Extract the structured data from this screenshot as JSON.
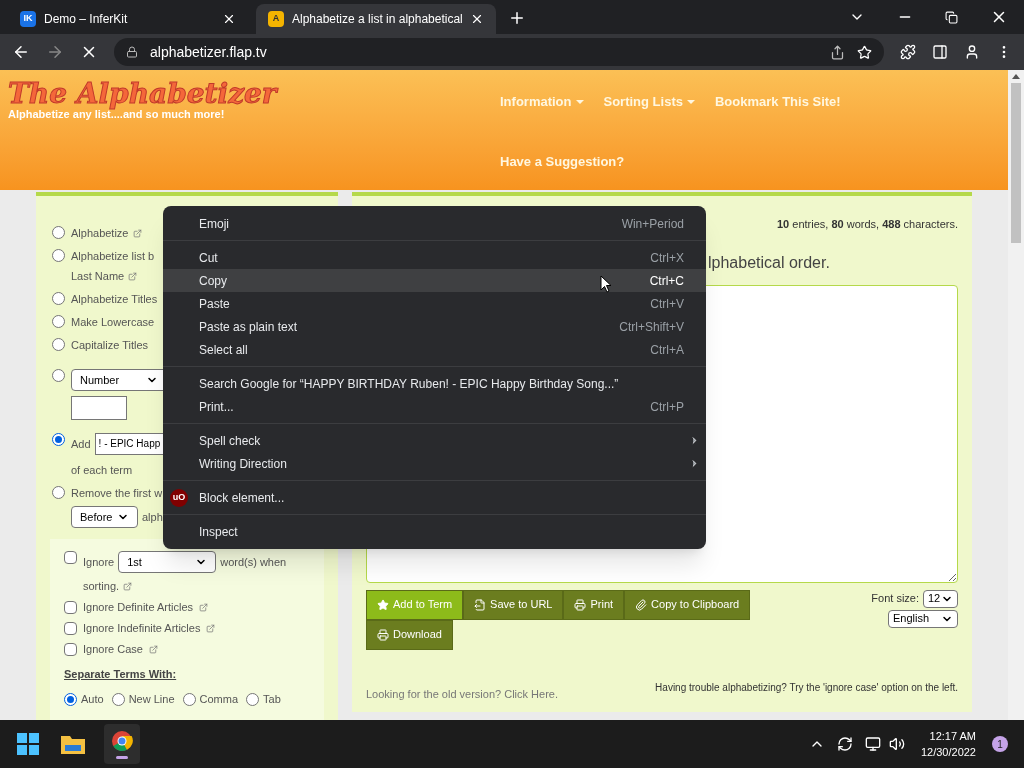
{
  "browser": {
    "tabs": [
      {
        "title": "Demo – InferKit",
        "icon_text": "IK",
        "selected": false
      },
      {
        "title": "Alphabetize a list in alphabetical",
        "icon_text": "A",
        "selected": true
      }
    ],
    "address": "alphabetizer.flap.tv"
  },
  "header": {
    "logo": "The Alphabetizer",
    "tagline": "Alphabetize any list....and so much more!",
    "nav": [
      {
        "label": "Information",
        "dropdown": true
      },
      {
        "label": "Sorting Lists",
        "dropdown": true
      },
      {
        "label": "Bookmark This Site!",
        "dropdown": false
      },
      {
        "label": "Have a Suggestion?",
        "dropdown": false
      }
    ]
  },
  "options": [
    {
      "kind": "radio",
      "label": "Alphabetize",
      "selected": false,
      "link": true
    },
    {
      "kind": "radio",
      "label": "Alphabetize list b",
      "selected": false,
      "link": true,
      "second_line": "Last Name"
    },
    {
      "kind": "radio",
      "label": "Alphabetize Titles",
      "selected": false,
      "link": false
    },
    {
      "kind": "radio",
      "label": "Make Lowercase",
      "selected": false,
      "link": false
    },
    {
      "kind": "radio",
      "label": "Capitalize Titles",
      "selected": false,
      "link": false
    },
    {
      "kind": "number",
      "select": "Number",
      "selected": false
    },
    {
      "kind": "add",
      "label": "Add",
      "value": "! - EPIC Happ",
      "after": "of each term",
      "selected": true
    },
    {
      "kind": "remove",
      "label": "Remove the first w",
      "select": "Before",
      "after": "alph",
      "selected": false
    }
  ],
  "ignore": {
    "checks": [
      {
        "kind": "words",
        "label": "Ignore",
        "select": "1st",
        "after": "word(s) when",
        "second_line": "sorting.",
        "checked": false
      },
      {
        "kind": "plain",
        "label": "Ignore Definite Articles",
        "checked": false
      },
      {
        "kind": "plain",
        "label": "Ignore Indefinite Articles",
        "checked": false
      },
      {
        "kind": "plain",
        "label": "Ignore Case",
        "checked": false
      }
    ],
    "separate_title": "Separate Terms With:",
    "separators": [
      {
        "label": "Auto",
        "selected": true
      },
      {
        "label": "New Line",
        "selected": false
      },
      {
        "label": "Comma",
        "selected": false
      },
      {
        "label": "Tab",
        "selected": false
      }
    ]
  },
  "editor": {
    "stats": "**10** entries, **80** words, **488** characters.",
    "heading": "lphabetical order.",
    "buttons": [
      {
        "label": "Add to Term",
        "primary": true
      },
      {
        "label": "Save to URL",
        "primary": false
      },
      {
        "label": "Print",
        "primary": false
      },
      {
        "label": "Copy to Clipboard",
        "primary": false
      },
      {
        "label": "Download",
        "primary": false
      }
    ],
    "font_size_label": "Font size:",
    "font_size": "12",
    "language": "English",
    "old_version": "Looking for the old version? Click Here.",
    "tip": "Having trouble alphabetizing? Try the 'ignore case' option on the left."
  },
  "context_menu": {
    "groups": [
      [
        {
          "label": "Emoji",
          "shortcut": "Win+Period",
          "selected": false
        }
      ],
      [
        {
          "label": "Cut",
          "shortcut": "Ctrl+X",
          "selected": false
        },
        {
          "label": "Copy",
          "shortcut": "Ctrl+C",
          "selected": true
        },
        {
          "label": "Paste",
          "shortcut": "Ctrl+V",
          "selected": false
        },
        {
          "label": "Paste as plain text",
          "shortcut": "Ctrl+Shift+V",
          "selected": false
        },
        {
          "label": "Select all",
          "shortcut": "Ctrl+A",
          "selected": false
        }
      ],
      [
        {
          "label": "Search Google for “HAPPY BIRTHDAY Ruben! - EPIC Happy Birthday Song...”",
          "selected": false
        },
        {
          "label": "Print...",
          "shortcut": "Ctrl+P",
          "selected": false
        }
      ],
      [
        {
          "label": "Spell check",
          "submenu": true,
          "selected": false
        },
        {
          "label": "Writing Direction",
          "submenu": true,
          "selected": false
        }
      ],
      [
        {
          "label": "Block element...",
          "icon_text": "uO",
          "selected": false
        }
      ],
      [
        {
          "label": "Inspect",
          "selected": false
        }
      ]
    ]
  },
  "taskbar": {
    "time": "12:17 AM",
    "date": "12/30/2022",
    "notifications": "1"
  }
}
